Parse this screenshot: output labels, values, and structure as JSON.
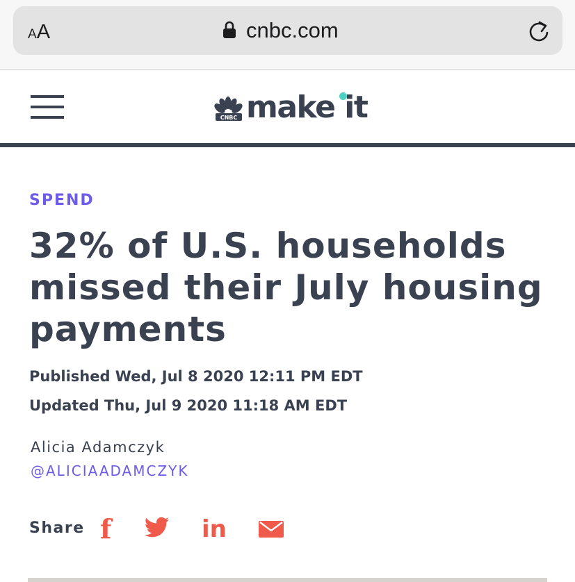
{
  "browser": {
    "text_size_small": "A",
    "text_size_large": "A",
    "domain": "cnbc.com"
  },
  "header": {
    "brand_mark": "CNBC",
    "logo_text": "make it"
  },
  "article": {
    "kicker": "SPEND",
    "headline": "32% of U.S. households missed their July housing payments",
    "published": "Published Wed, Jul 8 2020 12:11 PM EDT",
    "updated": "Updated Thu, Jul 9 2020 11:18 AM EDT",
    "author": "Alicia Adamczyk",
    "author_handle": "@ALICIAADAMCZYK"
  },
  "share": {
    "label": "Share",
    "facebook_glyph": "f",
    "linkedin_glyph": "in"
  },
  "colors": {
    "accent_purple": "#6c5ce7",
    "text_dark": "#3a4150",
    "share_red": "#f05a4a",
    "logo_dot": "#4fd1c1"
  }
}
